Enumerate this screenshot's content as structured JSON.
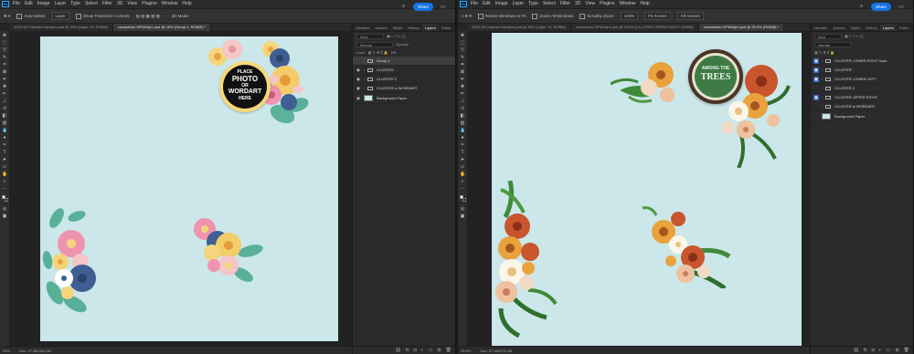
{
  "left": {
    "menus": [
      "File",
      "Edit",
      "Image",
      "Layer",
      "Type",
      "Select",
      "Filter",
      "3D",
      "View",
      "Plugins",
      "Window",
      "Help"
    ],
    "options": {
      "auto_select": "Auto-Select",
      "layer_dropdown": "Layer",
      "transform_controls": "Show Transform Controls",
      "mode_3d": "3D Mode:"
    },
    "share": "Share",
    "tabs": [
      "2022-4D Garman Gardens.psd @ 25% (Layer 19, RGB/8)",
      "cschneider-HP34Wp1.psd @ 25% (Group 1, RGB/8) *"
    ],
    "stamp": {
      "line1": "PLACE",
      "line2": "PHOTO",
      "line3": "OR",
      "line4": "WORDART",
      "line5": "HERE"
    },
    "status": {
      "zoom": "25%",
      "doc": "Doc: 37.3M/464.5M"
    },
    "panel_tabs": [
      "Libraries",
      "Actions",
      "Styles",
      "History",
      "Layers",
      "Paths"
    ],
    "kind": "Kind",
    "blend": "Normal",
    "opacity_label": "Opacity:",
    "lock_label": "Lock:",
    "fill_label": "Fill:",
    "layers": [
      "Group 1",
      "CLUSTER",
      "CLUSTER 2",
      "CLUSTER w WORDART",
      "Background Paper"
    ]
  },
  "right": {
    "menus": [
      "File",
      "Edit",
      "Image",
      "Layer",
      "Type",
      "Select",
      "Filter",
      "3D",
      "View",
      "Plugins",
      "Window",
      "Help"
    ],
    "options": {
      "resize": "Resize Windows to Fit",
      "zoom_all": "Zoom All Windows",
      "scrubby": "Scrubby Zoom",
      "zoom100": "100%",
      "fit": "Fit Screen",
      "fill": "Fill Screen"
    },
    "share": "Share",
    "tabs": [
      "2022-4D Garman Gardens.psd @ 25% (Layer 19, RGB/8)",
      "cschneider-HP34Wp1.psd @ 25.9% (CLUSTER UPPER RIGHT, RGB/8)",
      "cschneider-HP34Wp2.psd @ 25.9% (RGB/8) *"
    ],
    "stamp": {
      "line1": "AMONG THE",
      "line2": "TREES"
    },
    "status": {
      "zoom": "25.9%",
      "doc": "Doc: 37.3M/278.4M"
    },
    "panel_tabs": [
      "Libraries",
      "Actions",
      "Styles",
      "History",
      "Layers",
      "Paths"
    ],
    "kind": "Kind",
    "blend": "Normal",
    "layers": [
      "CLUSTER LOWER RIGHT back",
      "CLUSTER",
      "CLUSTER LOWER LEFT",
      "CLUSTER 2",
      "CLUSTER UPPER RIGHT",
      "CLUSTER w WORDART",
      "Background Paper"
    ]
  },
  "colors": {
    "canvas": "#cbe7ea",
    "accent": "#1473e6",
    "selected_eye": "#3a67c3"
  }
}
